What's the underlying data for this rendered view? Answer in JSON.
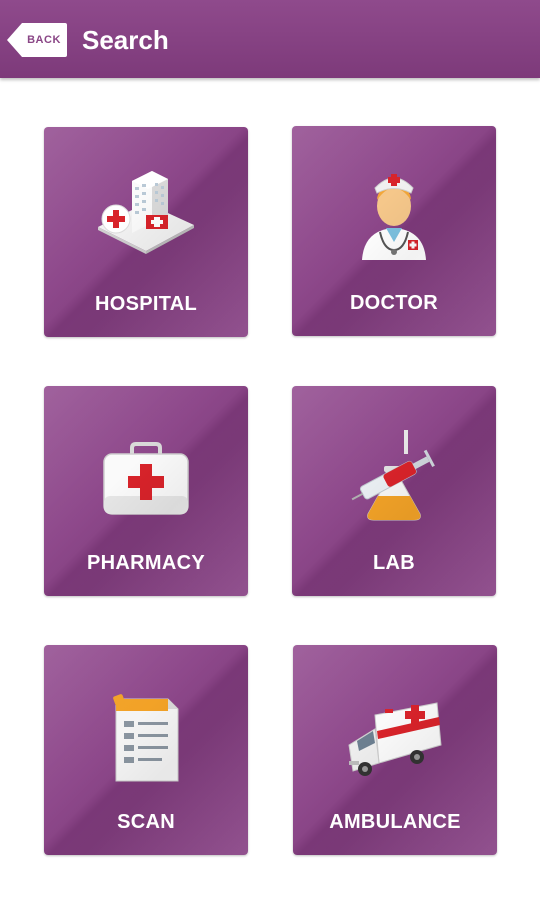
{
  "header": {
    "back_label": "BACK",
    "title": "Search"
  },
  "tiles": [
    {
      "label": "HOSPITAL",
      "icon": "hospital-icon"
    },
    {
      "label": "DOCTOR",
      "icon": "doctor-icon"
    },
    {
      "label": "PHARMACY",
      "icon": "first-aid-kit-icon"
    },
    {
      "label": "LAB",
      "icon": "lab-flask-syringe-icon"
    },
    {
      "label": "SCAN",
      "icon": "scan-report-icon"
    },
    {
      "label": "AMBULANCE",
      "icon": "ambulance-icon"
    }
  ],
  "colors": {
    "header_bg": "#8a4486",
    "tile_bg": "#8c4689",
    "text": "#ffffff",
    "medical_red": "#d8232a"
  }
}
